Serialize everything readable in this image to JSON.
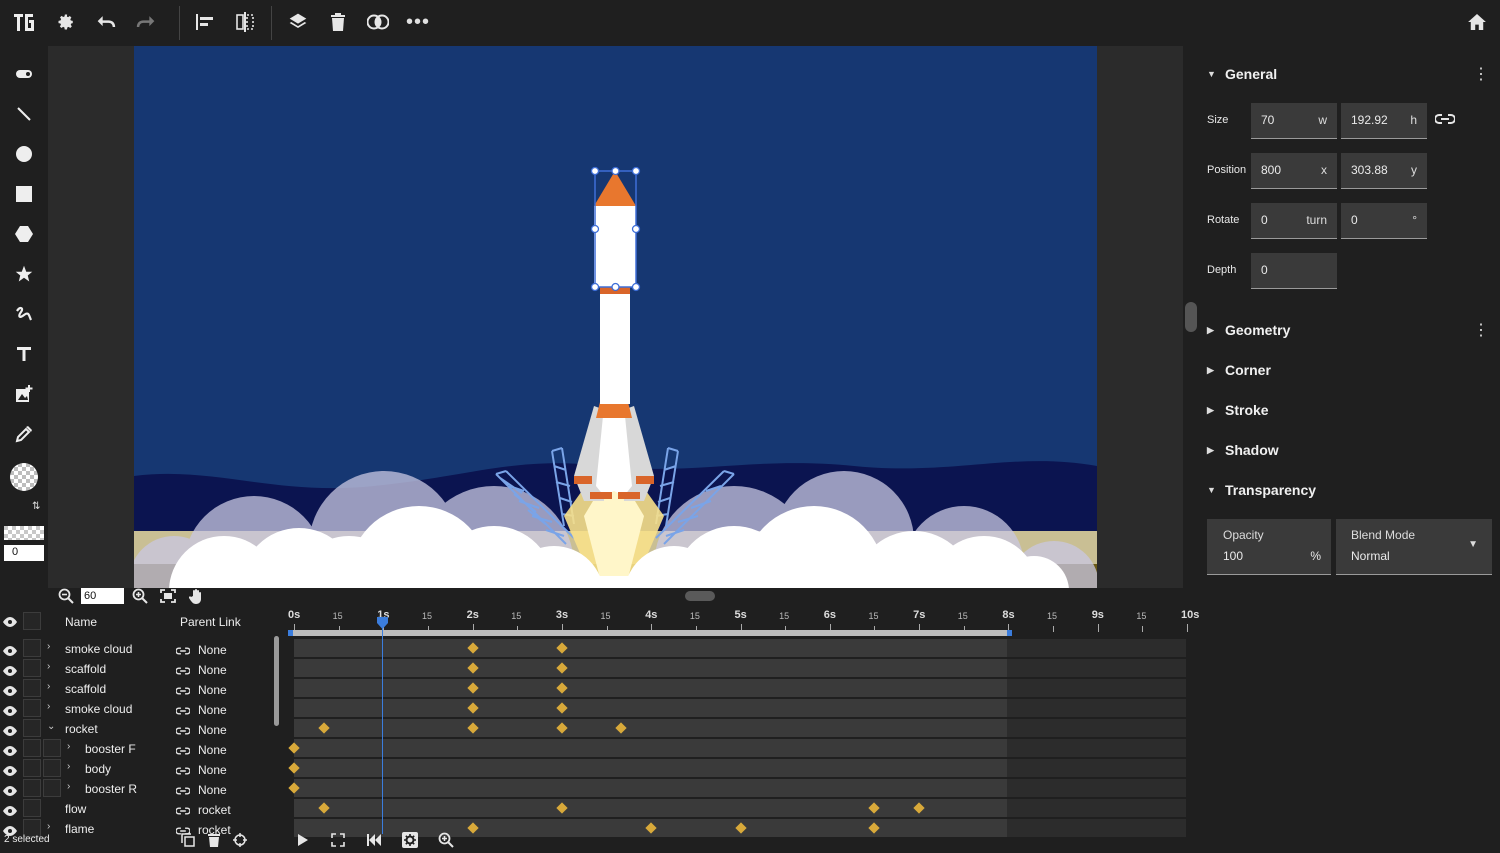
{
  "toolbar": {
    "icons": [
      "app-logo-icon",
      "settings-icon",
      "undo-icon",
      "redo-icon",
      "align-icon",
      "distribute-icon",
      "layers-icon",
      "delete-icon",
      "boolean-icon",
      "more-icon",
      "home-icon"
    ]
  },
  "left_tools": {
    "icons": [
      "pill-shape-icon",
      "line-icon",
      "circle-icon",
      "rectangle-icon",
      "hexagon-icon",
      "star-icon",
      "freehand-icon",
      "text-icon",
      "add-image-icon",
      "eyedropper-icon"
    ],
    "opacity_value": "0"
  },
  "panel": {
    "general": {
      "title": "General",
      "size_label": "Size",
      "size_w": "70",
      "size_w_unit": "w",
      "size_h": "192.92",
      "size_h_unit": "h",
      "position_label": "Position",
      "pos_x": "800",
      "pos_x_unit": "x",
      "pos_y": "303.88",
      "pos_y_unit": "y",
      "rotate_label": "Rotate",
      "rotate_turn": "0",
      "rotate_turn_unit": "turn",
      "rotate_deg": "0",
      "rotate_deg_unit": "°",
      "depth_label": "Depth",
      "depth": "0"
    },
    "sections": [
      "Geometry",
      "Corner",
      "Stroke",
      "Shadow"
    ],
    "transparency": {
      "title": "Transparency",
      "opacity_label": "Opacity",
      "opacity": "100",
      "opacity_unit": "%",
      "blend_label": "Blend Mode",
      "blend_value": "Normal"
    }
  },
  "zoom": {
    "value": "60"
  },
  "timeline": {
    "headers": {
      "name": "Name",
      "parent": "Parent Link"
    },
    "rows": [
      {
        "name": "smoke cloud",
        "parent": "None",
        "expand": "›"
      },
      {
        "name": "scaffold",
        "parent": "None",
        "expand": "›"
      },
      {
        "name": "scaffold",
        "parent": "None",
        "expand": "›"
      },
      {
        "name": "smoke cloud",
        "parent": "None",
        "expand": "›"
      },
      {
        "name": "rocket",
        "parent": "None",
        "expand": "⌄"
      },
      {
        "name": "booster F",
        "parent": "None",
        "expand": "›"
      },
      {
        "name": "body",
        "parent": "None",
        "expand": "›"
      },
      {
        "name": "booster R",
        "parent": "None",
        "expand": "›"
      },
      {
        "name": "flow",
        "parent": "rocket",
        "expand": ""
      },
      {
        "name": "flame",
        "parent": "rocket",
        "expand": "›"
      }
    ],
    "ruler": {
      "major": [
        "0s",
        "1s",
        "2s",
        "3s",
        "4s",
        "5s",
        "6s",
        "7s",
        "8s",
        "9s",
        "10s"
      ],
      "minor": "15"
    },
    "selected_text": "2 selected",
    "colors": {
      "keyframe": "#d8a93a",
      "playhead": "#3b7ddd",
      "sky": "#163772"
    }
  }
}
